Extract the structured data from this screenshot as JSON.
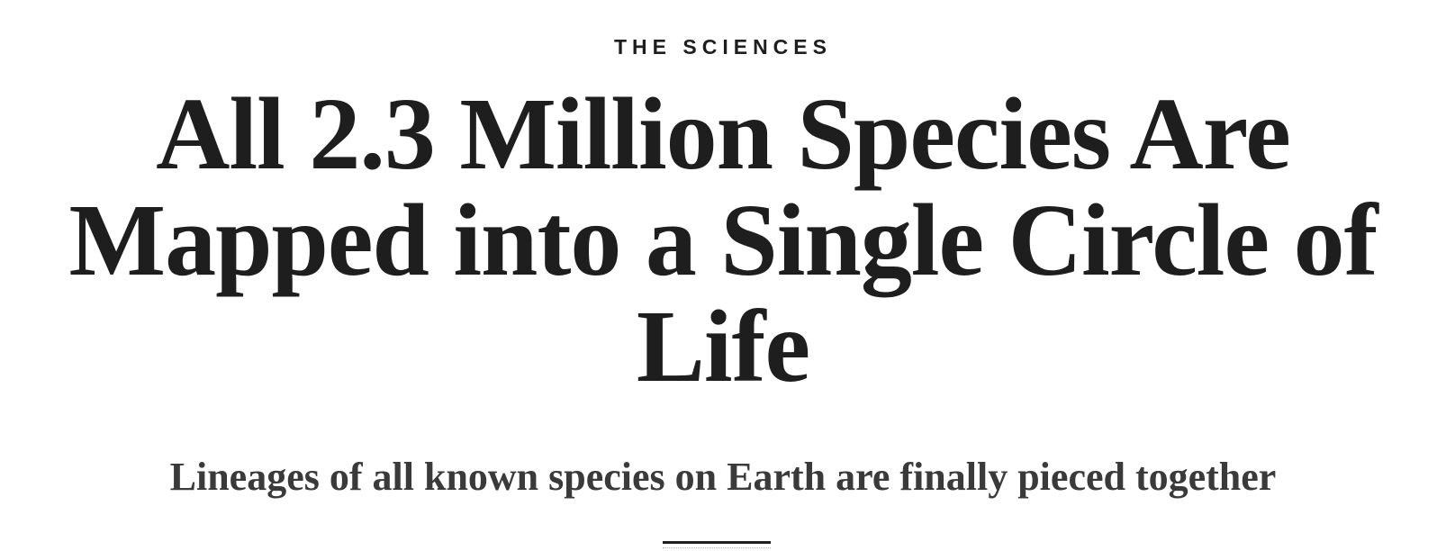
{
  "article": {
    "section": "THE SCIENCES",
    "headline": "All 2.3 Million Species Are Mapped into a Single Circle of Life",
    "subheadline": "Lineages of all known species on Earth are finally pieced together"
  }
}
